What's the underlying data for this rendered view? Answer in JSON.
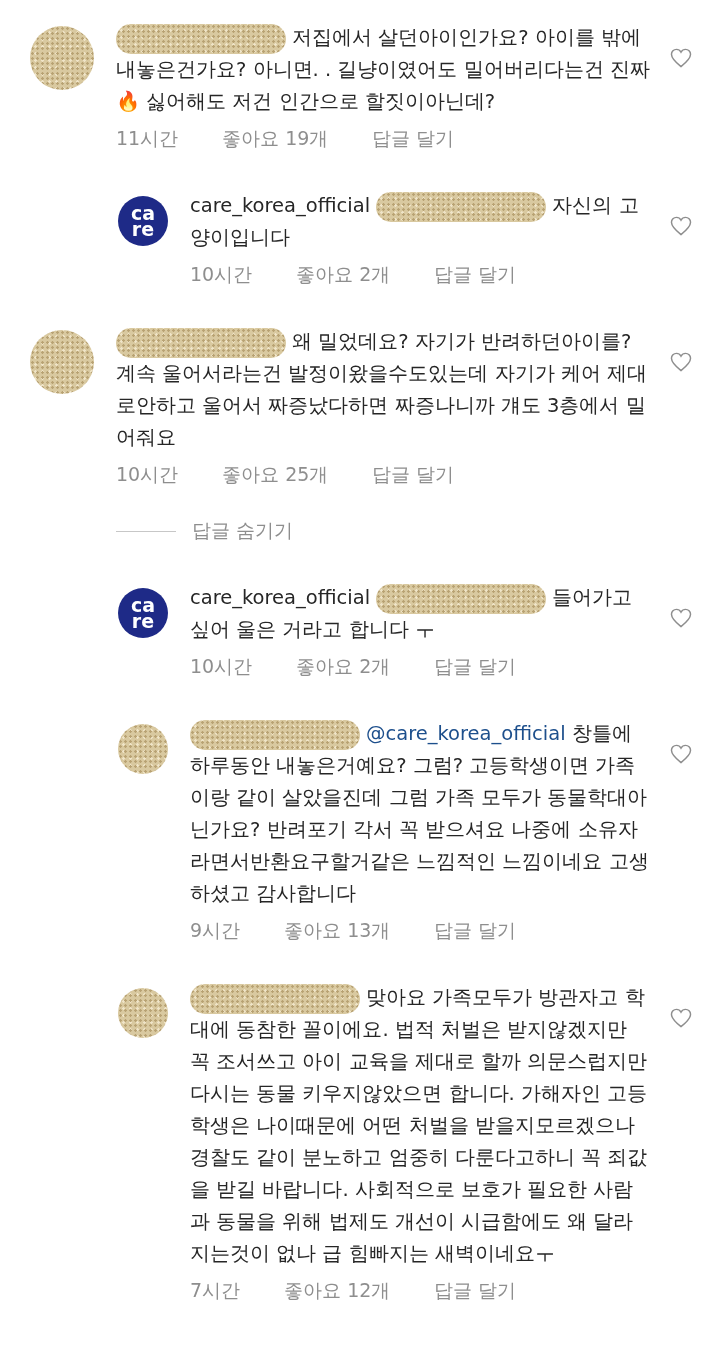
{
  "comments": [
    {
      "reply": false,
      "avatar": {
        "kind": "redacted"
      },
      "username_redacted": true,
      "text": "저집에서 살던아이인가요? 아이를 밖에내놓은건가요? 아니면. .  길냥이였어도 밀어버리다는건 진짜🔥 싫어해도 저건 인간으로 할짓이아닌데?",
      "time": "11시간",
      "likes": "좋아요 19개",
      "reply_label": "답글 달기"
    },
    {
      "reply": true,
      "avatar": {
        "kind": "logo",
        "text": [
          "ca",
          "re"
        ]
      },
      "username": "care_korea_official",
      "mention_redacted": true,
      "text": "자신의 고양이입니다",
      "time": "10시간",
      "likes": "좋아요 2개",
      "reply_label": "답글 달기"
    },
    {
      "reply": false,
      "avatar": {
        "kind": "redacted"
      },
      "username_redacted": true,
      "text": "왜 밀었데요? 자기가 반려하던아이를? 계속 울어서라는건 발정이왔을수도있는데 자기가 케어 제대로안하고 울어서 짜증났다하면 짜증나니까 걔도 3층에서 밀어줘요",
      "time": "10시간",
      "likes": "좋아요 25개",
      "reply_label": "답글 달기"
    },
    {
      "kind": "hide_replies",
      "label": "답글 숨기기"
    },
    {
      "reply": true,
      "avatar": {
        "kind": "logo",
        "text": [
          "ca",
          "re"
        ]
      },
      "username": "care_korea_official",
      "mention_redacted": true,
      "text": "들어가고 싶어 울은 거라고 합니다 ㅜ",
      "time": "10시간",
      "likes": "좋아요 2개",
      "reply_label": "답글 달기"
    },
    {
      "reply": true,
      "avatar": {
        "kind": "redacted"
      },
      "username_redacted": true,
      "mention": "@care_korea_official",
      "text": "창틀에 하루동안 내놓은거예요? 그럼? 고등학생이면 가족이랑 같이 살았을진데 그럼 가족 모두가 동물학대아닌가요? 반려포기 각서 꼭 받으셔요 나중에 소유자라면서반환요구할거같은 느낌적인 느낌이네요 고생하셨고 감사합니다",
      "time": "9시간",
      "likes": "좋아요 13개",
      "reply_label": "답글 달기"
    },
    {
      "reply": true,
      "avatar": {
        "kind": "redacted"
      },
      "username_redacted": true,
      "text": "맞아요 가족모두가 방관자고 학대에 동참한 꼴이에요. 법적 처벌은 받지않겠지만 꼭 조서쓰고 아이 교육을 제대로 할까 의문스럽지만 다시는 동물 키우지않았으면 합니다. 가해자인 고등학생은 나이때문에 어떤 처벌을 받을지모르겠으나 경찰도 같이 분노하고 엄중히 다룬다고하니 꼭 죄값을 받길 바랍니다. 사회적으로 보호가 필요한 사람과 동물을 위해 법제도 개선이 시급함에도 왜 달라지는것이 없나 급 힘빠지는 새벽이네요ㅜ",
      "time": "7시간",
      "likes": "좋아요 12개",
      "reply_label": "답글 달기"
    }
  ]
}
